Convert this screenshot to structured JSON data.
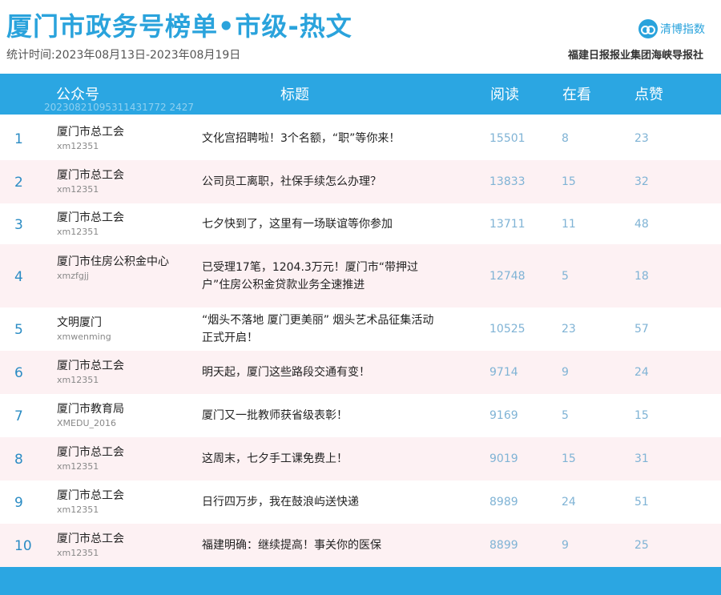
{
  "header": {
    "title": "厦门市政务号榜单•市级-热文",
    "period": "统计时间:2023年08月13日-2023年08月19日",
    "logo_text": "清博指数",
    "publisher": "福建日报报业集团海峡导报社"
  },
  "table": {
    "columns": [
      "公众号",
      "标题",
      "阅读",
      "在看",
      "点赞"
    ],
    "code": "20230821095311431772 2427",
    "rows": [
      {
        "rank": "1",
        "account": "厦门市总工会",
        "account_id": "xm12351",
        "title": "文化宫招聘啦！3个名额，“职”等你来！",
        "reads": "15501",
        "watching": "8",
        "likes": "23"
      },
      {
        "rank": "2",
        "account": "厦门市总工会",
        "account_id": "xm12351",
        "title": "公司员工离职，社保手续怎么办理？",
        "reads": "13833",
        "watching": "15",
        "likes": "32"
      },
      {
        "rank": "3",
        "account": "厦门市总工会",
        "account_id": "xm12351",
        "title": "七夕快到了，这里有一场联谊等你参加",
        "reads": "13711",
        "watching": "11",
        "likes": "48"
      },
      {
        "rank": "4",
        "account": "厦门市住房公积金中心",
        "account_id": "xmzfgjj",
        "title": "已受理17笔，1204.3万元！厦门市“带押过户”住房公积金贷款业务全速推进",
        "reads": "12748",
        "watching": "5",
        "likes": "18"
      },
      {
        "rank": "5",
        "account": "文明厦门",
        "account_id": "xmwenming",
        "title": "“烟头不落地 厦门更美丽” 烟头艺术品征集活动正式开启！",
        "reads": "10525",
        "watching": "23",
        "likes": "57"
      },
      {
        "rank": "6",
        "account": "厦门市总工会",
        "account_id": "xm12351",
        "title": "明天起，厦门这些路段交通有变！",
        "reads": "9714",
        "watching": "9",
        "likes": "24"
      },
      {
        "rank": "7",
        "account": "厦门市教育局",
        "account_id": "XMEDU_2016",
        "title": "厦门又一批教师获省级表彰！",
        "reads": "9169",
        "watching": "5",
        "likes": "15"
      },
      {
        "rank": "8",
        "account": "厦门市总工会",
        "account_id": "xm12351",
        "title": "这周末，七夕手工课免费上！",
        "reads": "9019",
        "watching": "15",
        "likes": "31"
      },
      {
        "rank": "9",
        "account": "厦门市总工会",
        "account_id": "xm12351",
        "title": "日行四万步，我在鼓浪屿送快递",
        "reads": "8989",
        "watching": "24",
        "likes": "51"
      },
      {
        "rank": "10",
        "account": "厦门市总工会",
        "account_id": "xm12351",
        "title": "福建明确：继续提高！事关你的医保",
        "reads": "8899",
        "watching": "9",
        "likes": "25"
      }
    ]
  }
}
